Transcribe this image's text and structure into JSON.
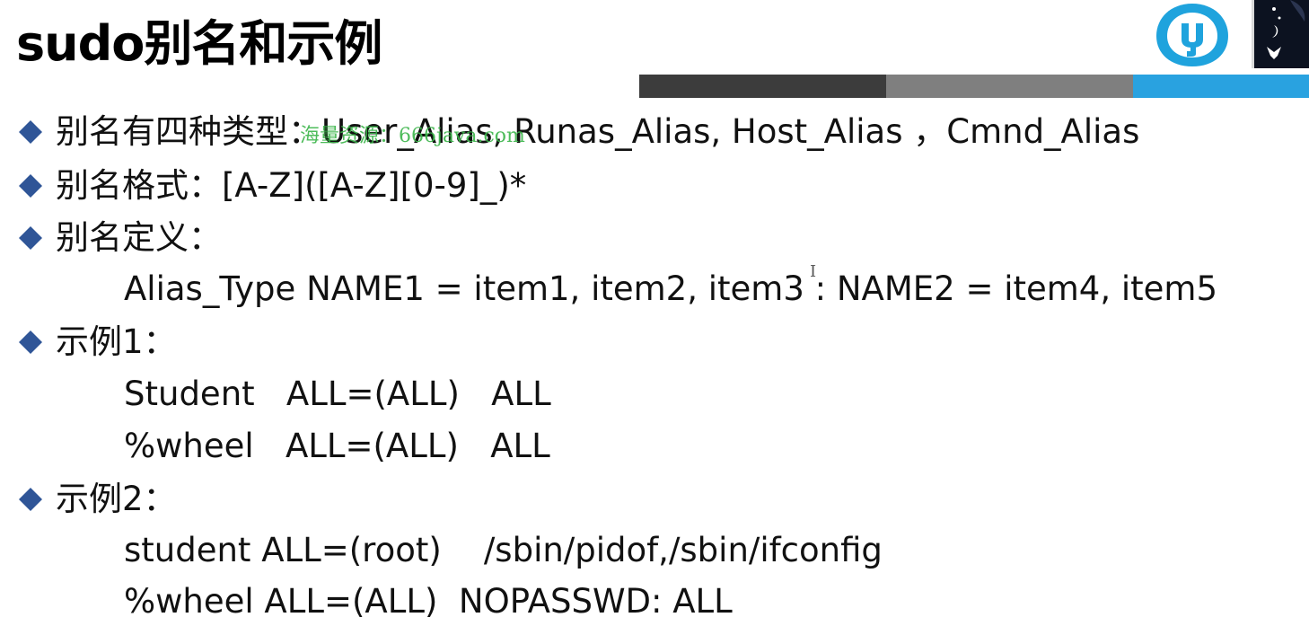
{
  "slide": {
    "title": "sudo别名和示例",
    "watermark": "海量资源：666java.com",
    "colors": {
      "bullet": "#2f5597",
      "bar_dark": "#3c3c3c",
      "bar_mid": "#7f7f7f",
      "bar_blue": "#29a2e0",
      "logo_blue": "#1fa3dd"
    },
    "bullets": [
      {
        "text": "别名有四种类型：User_Alias, Runas_Alias, Host_Alias ，Cmnd_Alias"
      },
      {
        "text": "别名格式：[A-Z]([A-Z][0-9]_)*"
      },
      {
        "text": "别名定义："
      },
      {
        "text": "示例1："
      },
      {
        "text": "示例2："
      }
    ],
    "definition_line": "Alias_Type NAME1 = item1, item2, item3 : NAME2 = item4, item5",
    "example1": {
      "line1": "Student   ALL=(ALL)   ALL",
      "line2": "%wheel   ALL=(ALL)   ALL"
    },
    "example2": {
      "line1": "student ALL=(root)    /sbin/pidof,/sbin/ifconfig",
      "line2": "%wheel ALL=(ALL)  NOPASSWD: ALL"
    },
    "cursor_glyph": "I"
  }
}
